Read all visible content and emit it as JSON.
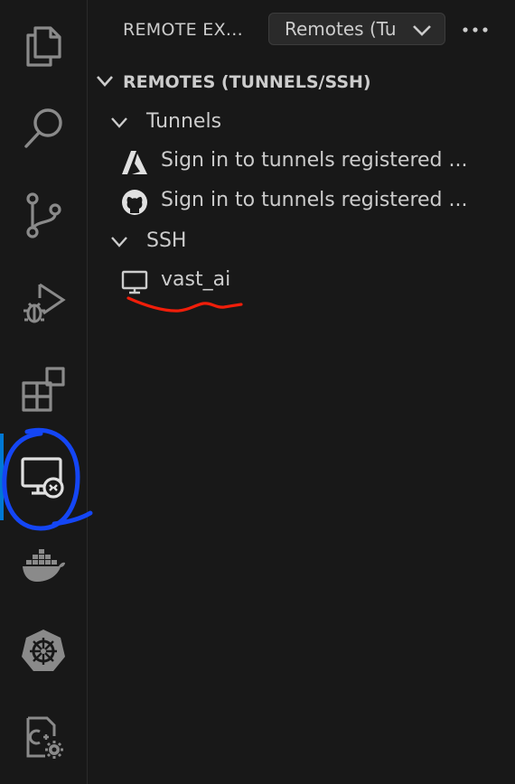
{
  "sidebar": {
    "title": "REMOTE EX...",
    "dropdown_value": "Remotes (Tu",
    "more_actions": "···",
    "section_title": "REMOTES (TUNNELS/SSH)",
    "tunnels_group": "Tunnels",
    "tunnel_items": [
      {
        "label": "Sign in to tunnels registered ...",
        "icon": "azure-icon"
      },
      {
        "label": "Sign in to tunnels registered ...",
        "icon": "github-icon"
      }
    ],
    "ssh_group": "SSH",
    "ssh_items": [
      {
        "label": "vast_ai",
        "icon": "monitor-icon"
      }
    ]
  },
  "activity_bar": [
    {
      "icon": "explorer-icon"
    },
    {
      "icon": "search-icon"
    },
    {
      "icon": "source-control-icon"
    },
    {
      "icon": "run-debug-icon"
    },
    {
      "icon": "extensions-icon"
    },
    {
      "icon": "remote-explorer-icon",
      "active": true
    },
    {
      "icon": "docker-icon"
    },
    {
      "icon": "kubernetes-icon"
    },
    {
      "icon": "cpp-config-icon"
    }
  ],
  "colors": {
    "background": "#181818",
    "text": "#cccccc",
    "accent": "#0078d4",
    "annotation_blue": "#1446f5",
    "annotation_red": "#f01e0a"
  }
}
